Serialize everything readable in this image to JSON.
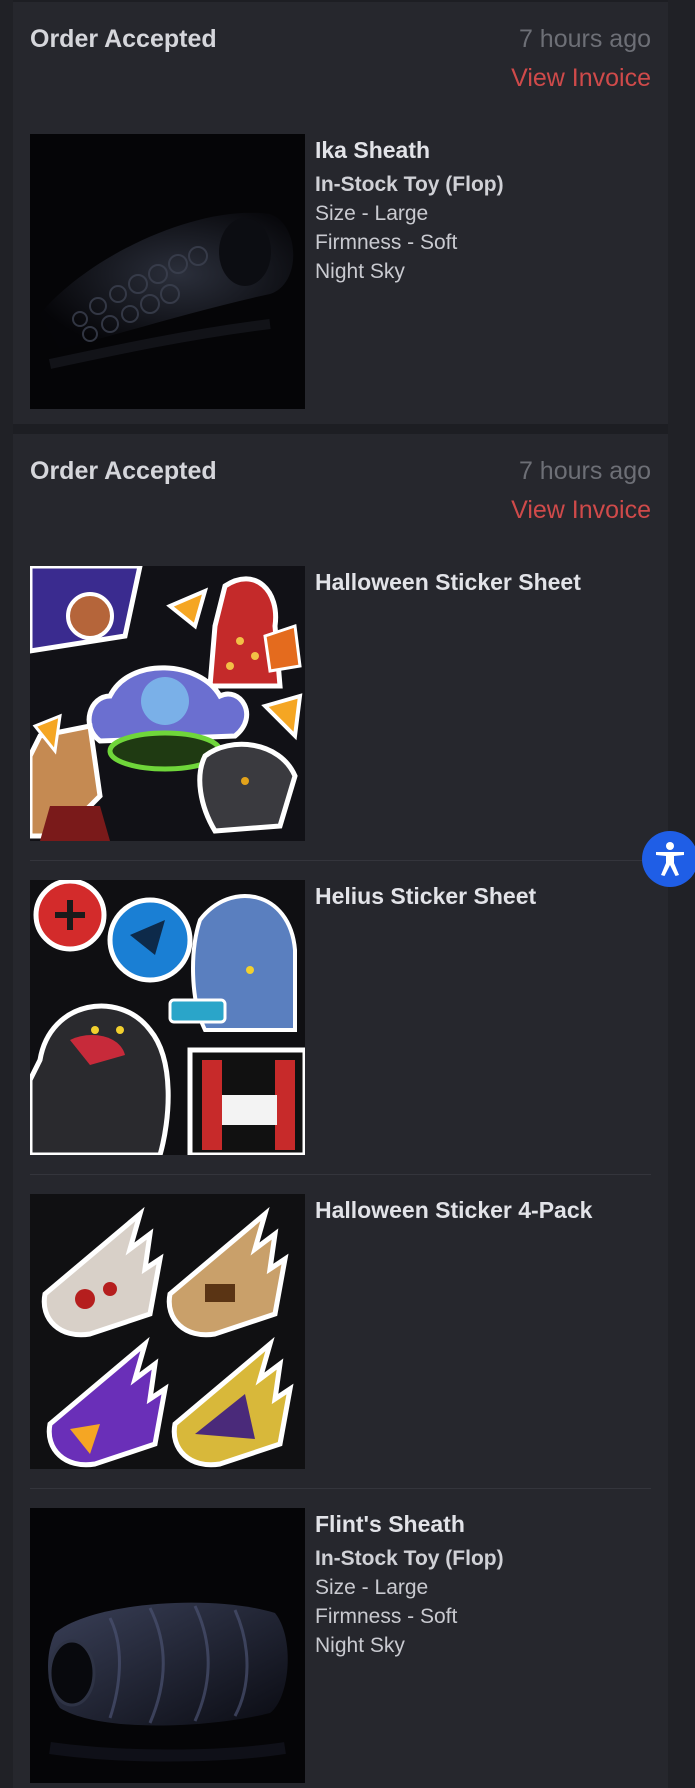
{
  "orders": [
    {
      "status": "Order Accepted",
      "time": "7 hours ago",
      "invoice_label": "View Invoice",
      "items": [
        {
          "title": "Ika Sheath",
          "subtitle": "In-Stock Toy (Flop)",
          "details": [
            "Size - Large",
            "Firmness - Soft",
            "Night Sky"
          ],
          "image": "dark-tentacle-sheath-photo"
        }
      ]
    },
    {
      "status": "Order Accepted",
      "time": "7 hours ago",
      "invoice_label": "View Invoice",
      "items": [
        {
          "title": "Halloween Sticker Sheet",
          "image": "halloween-sticker-sheet-art"
        },
        {
          "title": "Helius Sticker Sheet",
          "image": "helius-sticker-sheet-art"
        },
        {
          "title": "Halloween Sticker 4-Pack",
          "image": "halloween-sticker-4-pack-art"
        },
        {
          "title": "Flint's Sheath",
          "subtitle": "In-Stock Toy (Flop)",
          "details": [
            "Size - Large",
            "Firmness - Soft",
            "Night Sky"
          ],
          "image": "dark-sheath-photo"
        }
      ]
    }
  ],
  "accessibility": {
    "icon": "accessibility-icon"
  },
  "colors": {
    "background": "#202126",
    "card": "#26272d",
    "accent": "#cf4a4a",
    "muted": "#6d6f76",
    "accessibility_blue": "#1f5ee6"
  }
}
